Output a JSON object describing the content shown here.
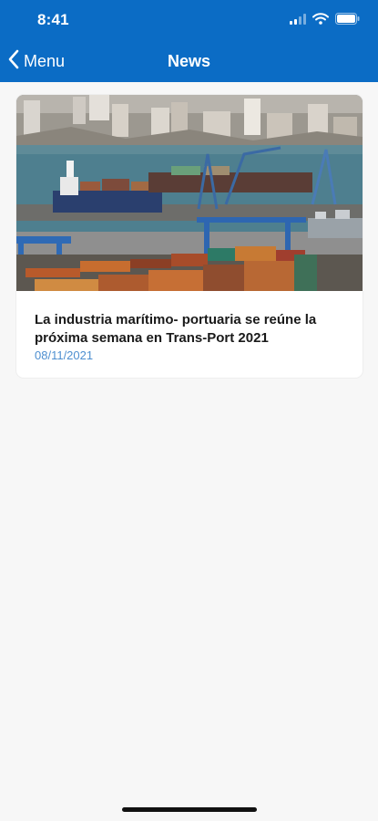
{
  "status_bar": {
    "time": "8:41"
  },
  "nav": {
    "back_label": "Menu",
    "title": "News"
  },
  "news": {
    "items": [
      {
        "title": "La industria marítimo- portuaria se reúne la próxima semana en Trans-Port 2021",
        "date": "08/11/2021"
      }
    ]
  },
  "colors": {
    "header": "#0b6cc5",
    "background": "#f7f7f7",
    "date": "#4e8fd0"
  },
  "icons": [
    "signal-icon",
    "wifi-icon",
    "battery-icon",
    "chevron-left-icon"
  ]
}
